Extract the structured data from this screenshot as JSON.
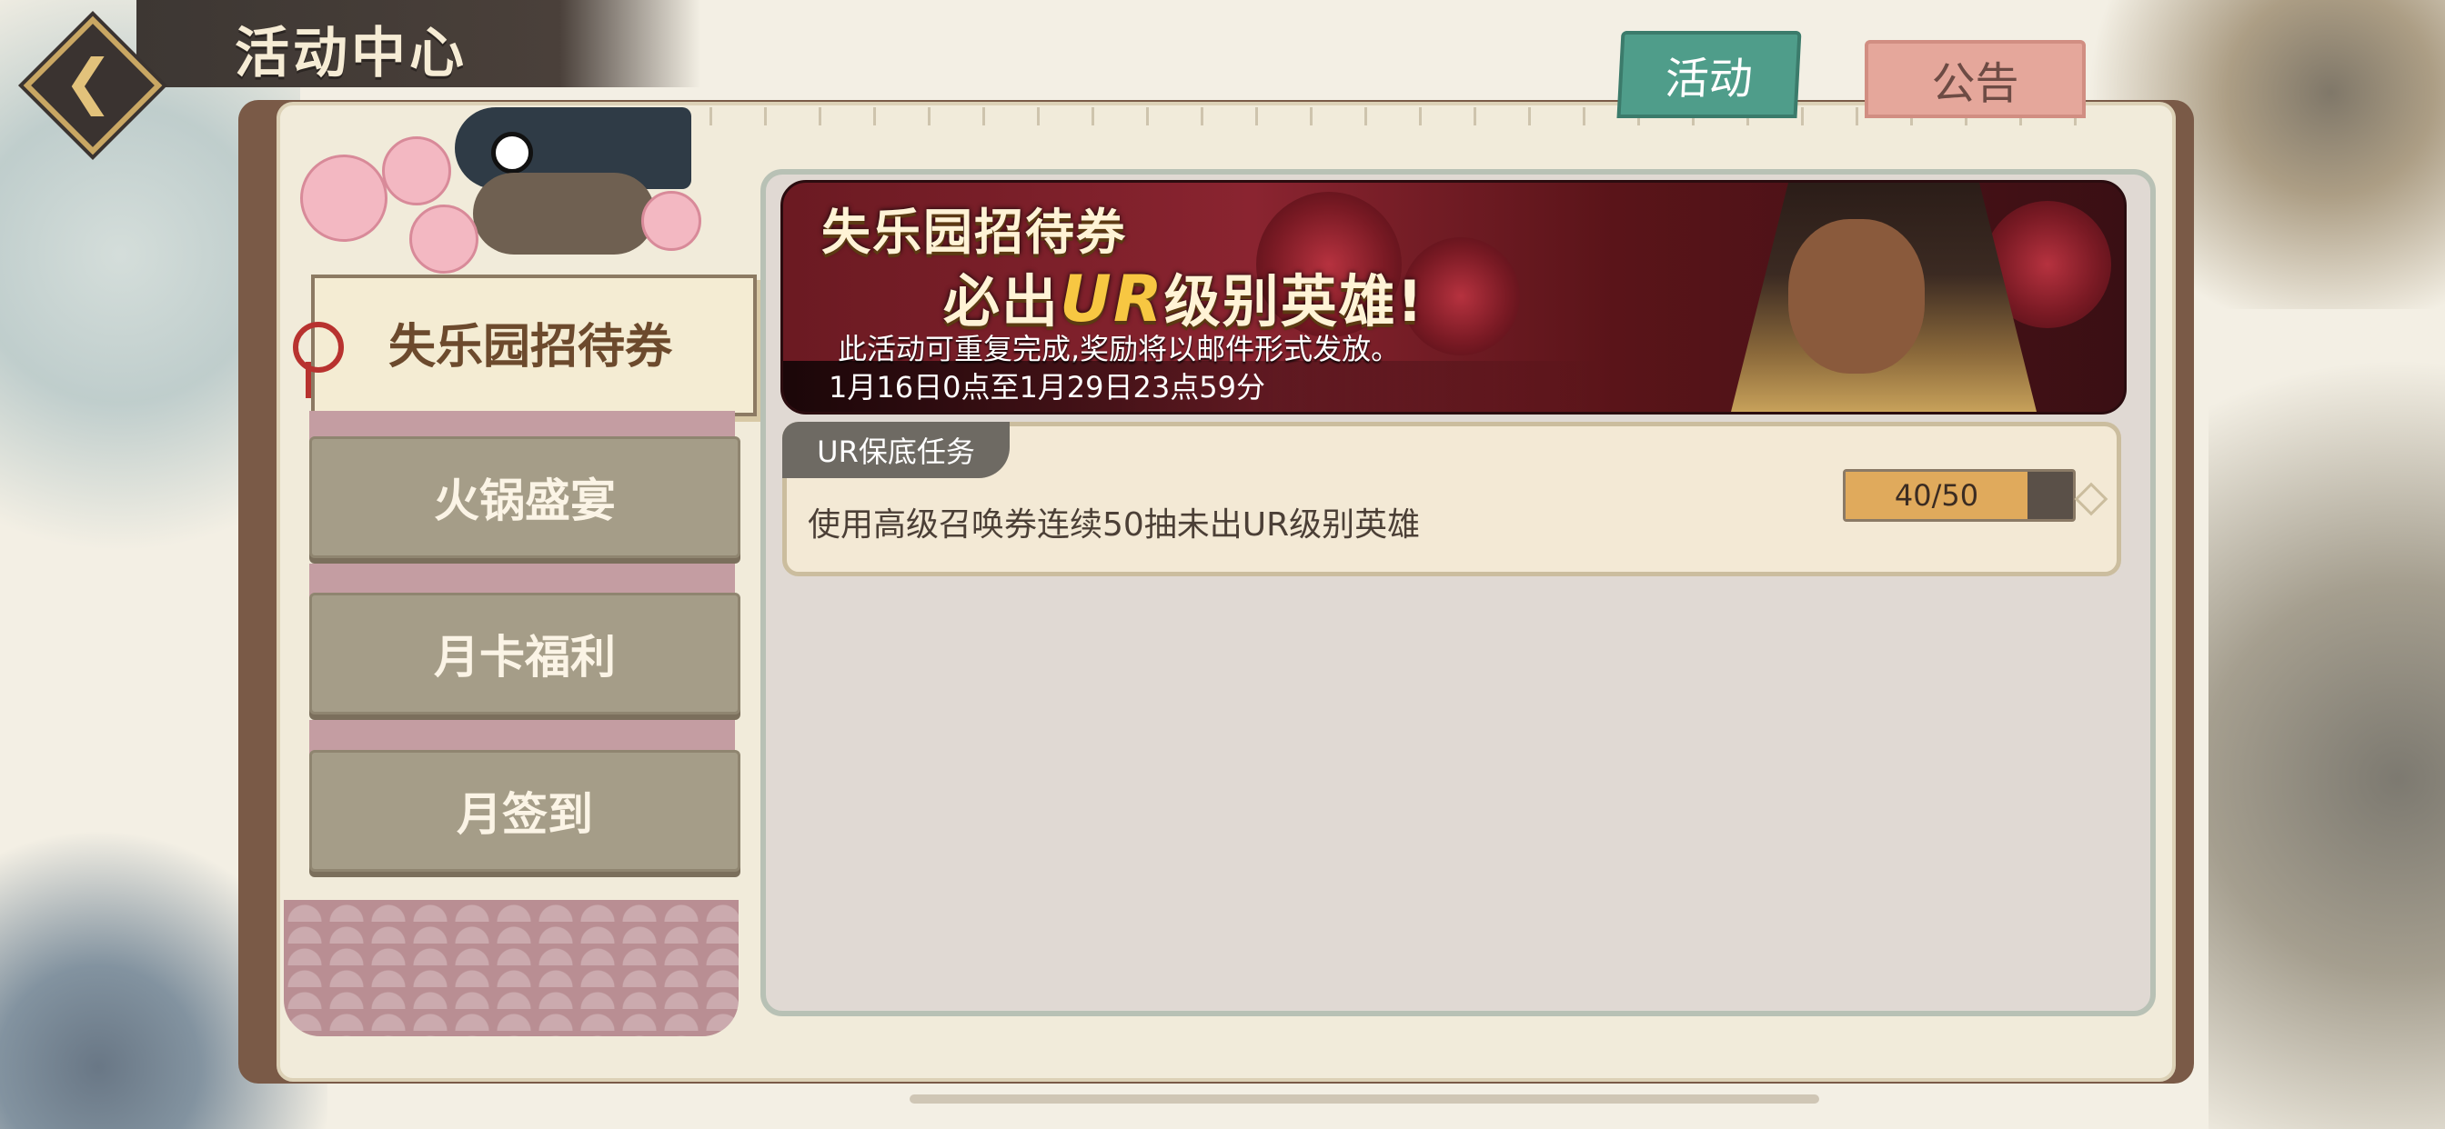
{
  "header": {
    "title": "活动中心",
    "back_glyph": "❮"
  },
  "tabs": [
    {
      "label": "活动",
      "active": true
    },
    {
      "label": "公告",
      "active": false
    }
  ],
  "sidebar": {
    "items": [
      {
        "label": "失乐园招待券",
        "selected": true
      },
      {
        "label": "火锅盛宴",
        "selected": false
      },
      {
        "label": "月卡福利",
        "selected": false
      },
      {
        "label": "月签到",
        "selected": false
      }
    ]
  },
  "banner": {
    "title_line1": "失乐园招待券",
    "title_line2_prefix": "必出",
    "title_line2_highlight": "UR",
    "title_line2_suffix": "级别英雄!",
    "note": "此活动可重复完成,奖励将以邮件形式发放。",
    "date_range": "1月16日0点至1月29日23点59分"
  },
  "task": {
    "tag": "UR保底任务",
    "description": "使用高级召唤券连续50抽未出UR级别英雄",
    "progress_text": "40/50",
    "progress_current": 40,
    "progress_total": 50
  },
  "colors": {
    "tab_active": "#4f9d8a",
    "tab_inactive": "#e5a79b",
    "progress_fill": "#e0aa5c"
  }
}
